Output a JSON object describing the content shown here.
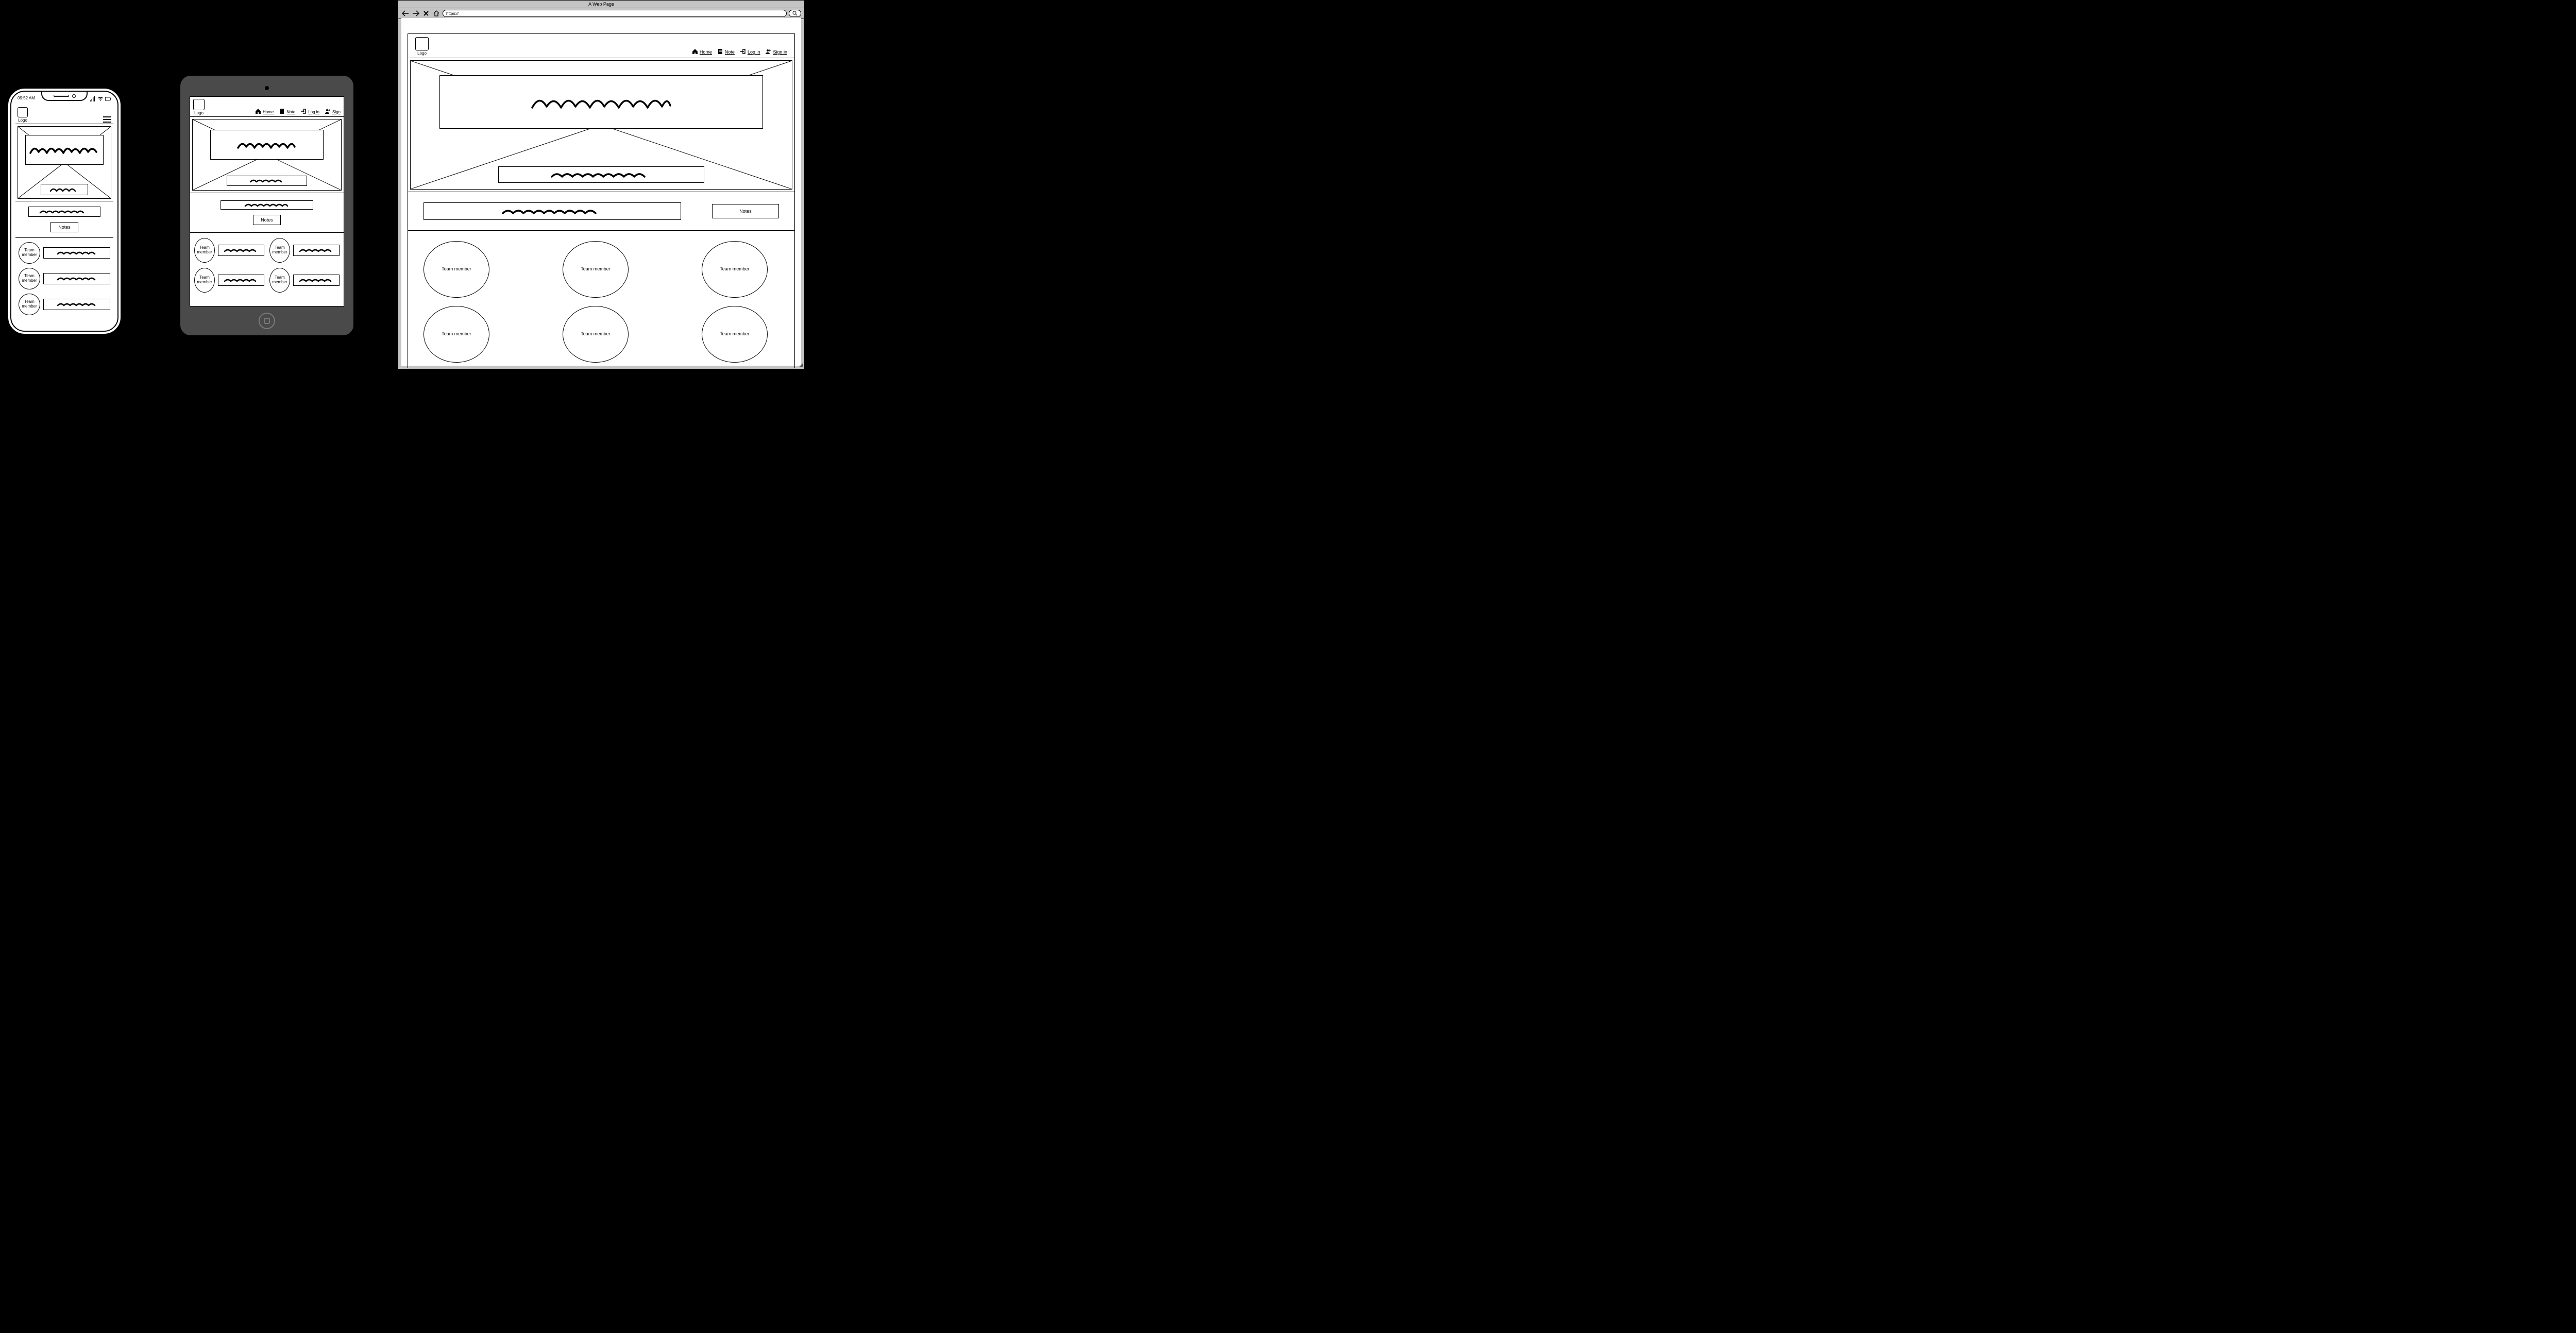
{
  "browser": {
    "window_title": "A Web Page",
    "url": "https://"
  },
  "phone_status_time": "09:52 AM",
  "logo_label": "Logo",
  "nav": {
    "home": "Home",
    "note": "Note",
    "login": "Log in",
    "signin": "Sign in",
    "signin_short": "Sign"
  },
  "notes_button": "Notes",
  "team_label": "Team member"
}
